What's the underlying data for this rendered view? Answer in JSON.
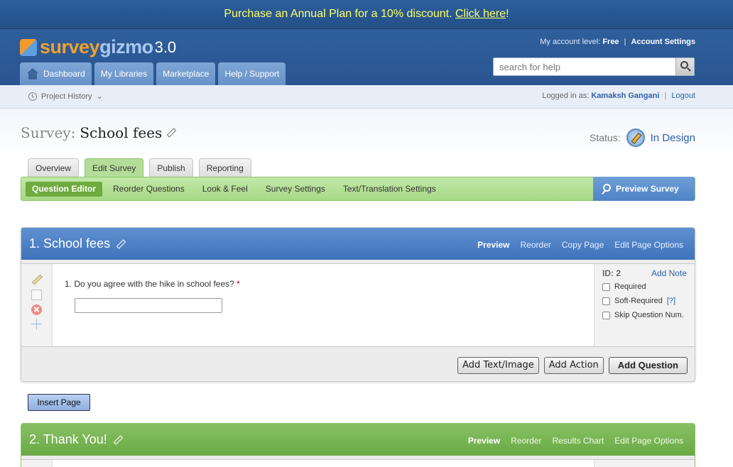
{
  "promo": {
    "text": "Purchase an Annual Plan for a 10% discount.",
    "link": "Click here",
    "suffix": "!"
  },
  "brand": {
    "name_part1": "survey",
    "name_part2": "gizmo",
    "version": "3.0"
  },
  "nav": {
    "items": [
      "Dashboard",
      "My Libraries",
      "Marketplace",
      "Help / Support"
    ]
  },
  "account": {
    "level_label": "My account level:",
    "level_value": "Free",
    "settings_link": "Account Settings"
  },
  "search": {
    "placeholder": "search for help"
  },
  "subbar": {
    "history": "Project History",
    "logged_label": "Logged in as:",
    "user": "Kamaksh Gangani",
    "logout": "Logout"
  },
  "survey": {
    "label": "Survey:",
    "name": "School fees",
    "status_label": "Status:",
    "status_value": "In Design"
  },
  "survey_tabs": [
    "Overview",
    "Edit Survey",
    "Publish",
    "Reporting"
  ],
  "editor_menu": {
    "items": [
      "Question Editor",
      "Reorder Questions",
      "Look & Feel",
      "Survey Settings",
      "Text/Translation Settings"
    ],
    "preview": "Preview Survey"
  },
  "page1": {
    "title": "1. School fees",
    "links": [
      "Preview",
      "Reorder",
      "Copy Page",
      "Edit Page Options"
    ],
    "question": {
      "text": "1. Do you agree with the hike in school fees?",
      "required_mark": "*",
      "id_label": "ID: 2",
      "add_note": "Add Note",
      "options": [
        "Required",
        "Soft-Required",
        "Skip Question Num."
      ],
      "soft_help": "[?]"
    },
    "buttons": [
      "Add Text/Image",
      "Add Action",
      "Add Question"
    ]
  },
  "insert_page": "Insert Page",
  "page2": {
    "title": "2. Thank You!",
    "links": [
      "Preview",
      "Reorder",
      "Results Chart",
      "Edit Page Options"
    ]
  },
  "colors": {
    "header_blue": "#2f5f9b",
    "promo_text": "#ffff66",
    "accent_green": "#6fab3f",
    "link_blue": "#2f62a8"
  }
}
